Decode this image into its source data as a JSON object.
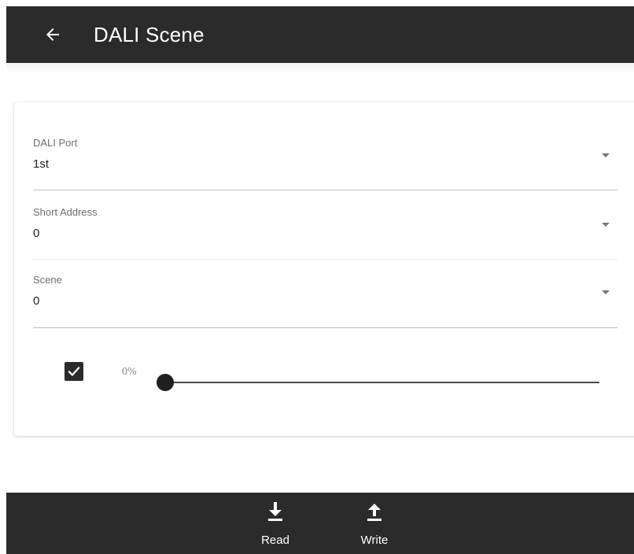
{
  "app_bar": {
    "title": "DALI Scene",
    "back_icon": "arrow-left-icon",
    "background": "#2b2b2b"
  },
  "form": {
    "fields": [
      {
        "label": "DALI Port",
        "value": "1st"
      },
      {
        "label": "Short Address",
        "value": "0"
      },
      {
        "label": "Scene",
        "value": "0"
      }
    ],
    "level_enabled": true,
    "level_text": "0%",
    "level_value": 0
  },
  "bottom_bar": {
    "actions": [
      {
        "label": "Read",
        "icon": "download-icon"
      },
      {
        "label": "Write",
        "icon": "upload-icon"
      }
    ]
  }
}
